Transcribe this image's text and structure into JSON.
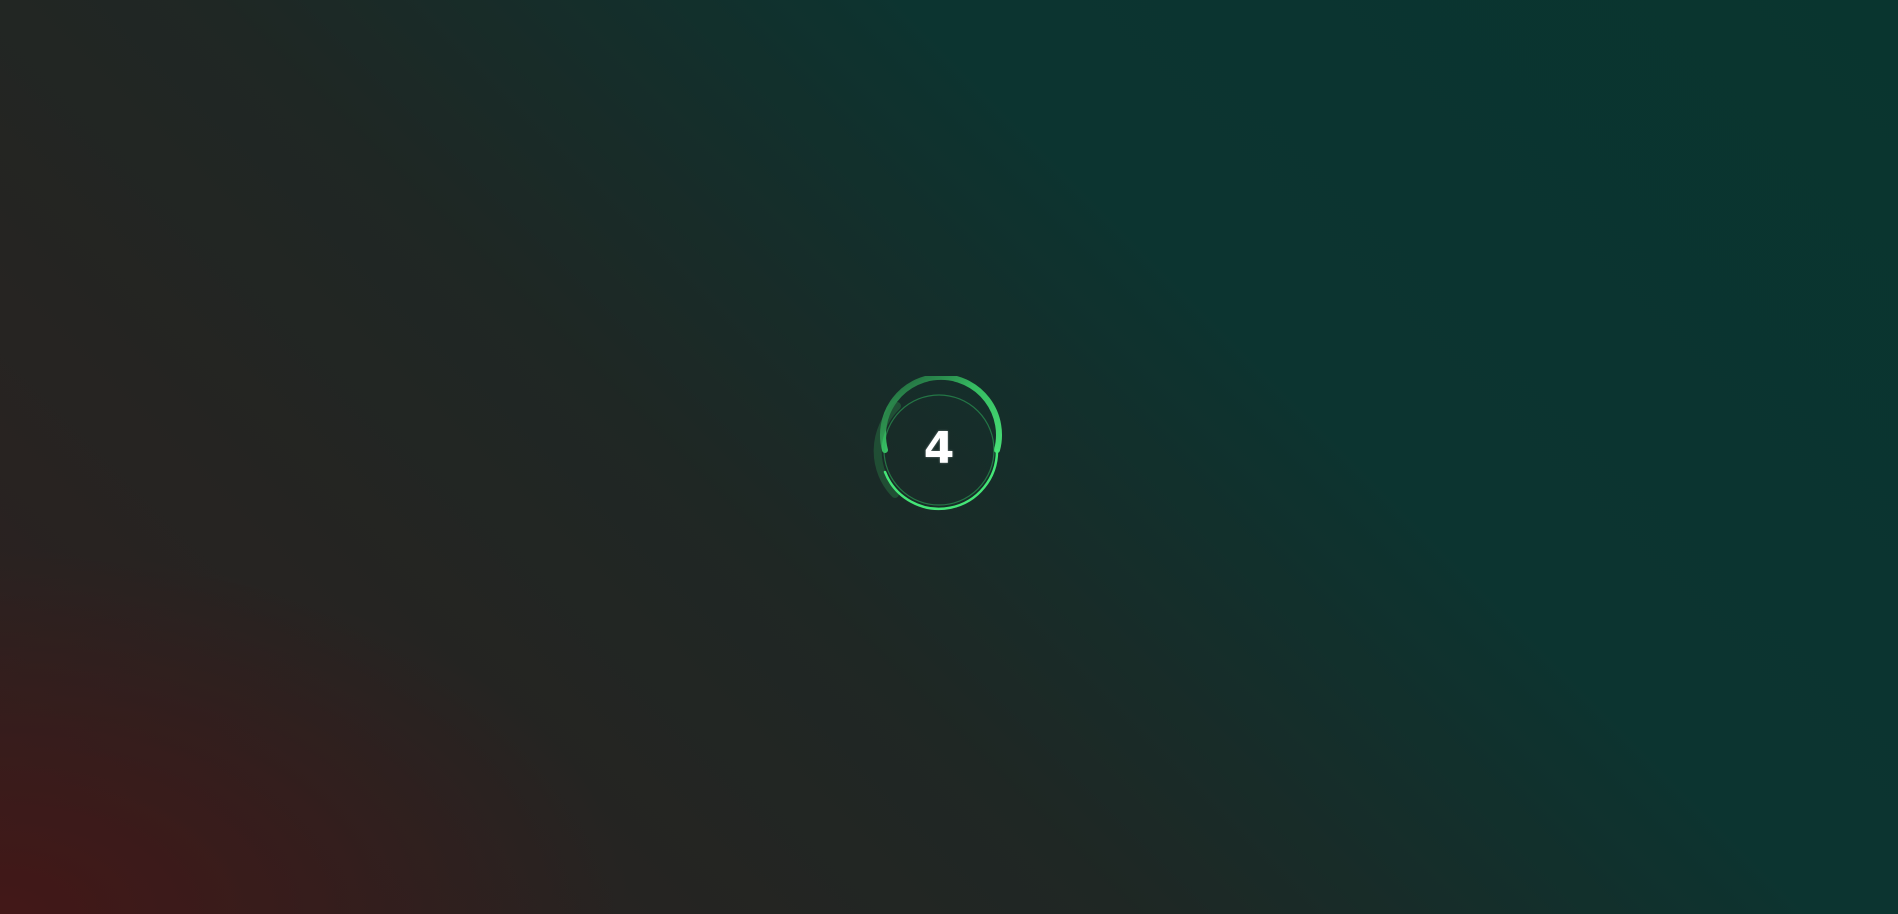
{
  "countdown": {
    "value": "4",
    "ring_color": "#3ddc6e"
  },
  "background": {
    "primary": "#09352f",
    "accent": "#3b1a1a"
  }
}
